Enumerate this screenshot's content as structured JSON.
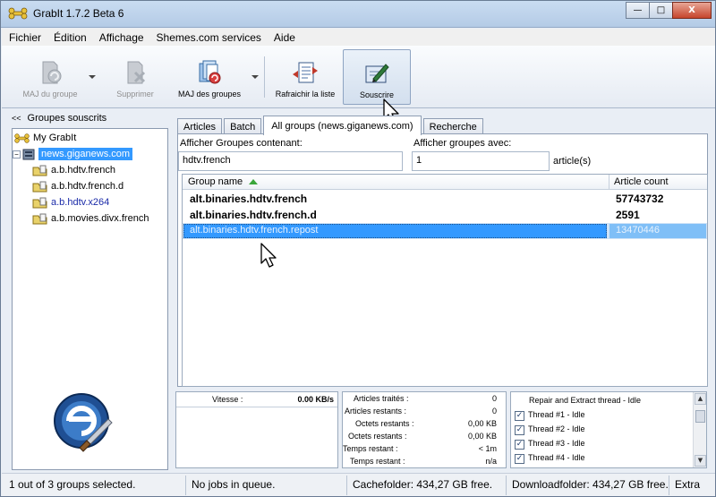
{
  "window": {
    "title": "GrabIt 1.7.2 Beta 6",
    "minimize": "—",
    "maximize": "□",
    "close": "X"
  },
  "menu": [
    "Fichier",
    "Édition",
    "Affichage",
    "Shemes.com services",
    "Aide"
  ],
  "toolbar": {
    "maj_groupe": "MAJ du groupe",
    "supprimer": "Supprimer",
    "maj_groupes": "MAJ des groupes",
    "rafraichir": "Rafraichir la liste",
    "souscrire": "Souscrire"
  },
  "left": {
    "header": "Groupes souscrits",
    "chevron": "<<",
    "tree": {
      "root": "My GrabIt",
      "server": "news.giganews.com",
      "expander": "−",
      "groups": [
        "a.b.hdtv.french",
        "a.b.hdtv.french.d",
        "a.b.hdtv.x264",
        "a.b.movies.divx.french"
      ]
    }
  },
  "tabs": [
    "Articles",
    "Batch",
    "All groups (news.giganews.com)",
    "Recherche"
  ],
  "filter": {
    "contain_label": "Afficher Groupes contenant:",
    "contain_value": "hdtv.french",
    "with_label": "Afficher groupes avec:",
    "with_value": "1",
    "with_unit": "article(s)"
  },
  "grid": {
    "col_name": "Group name",
    "col_count": "Article count",
    "rows": [
      {
        "name": "alt.binaries.hdtv.french",
        "count": "57743732"
      },
      {
        "name": "alt.binaries.hdtv.french.d",
        "count": "2591"
      },
      {
        "name": "alt.binaries.hdtv.french.repost",
        "count": "13470446"
      }
    ]
  },
  "speed": {
    "label": "Vitesse :",
    "value": "0.00 KB/s"
  },
  "stats": [
    {
      "label": "Articles traités :",
      "value": "0"
    },
    {
      "label": "Articles restants :",
      "value": "0"
    },
    {
      "label": "Octets restants :",
      "value": "0,00 KB"
    },
    {
      "label": "Octets restants :",
      "value": "0,00 KB"
    },
    {
      "label": "Temps restant :",
      "value": "< 1m"
    },
    {
      "label": "Temps restant :",
      "value": "n/a"
    }
  ],
  "threads": {
    "header": "Repair and Extract thread - Idle",
    "items": [
      "Thread #1 - Idle",
      "Thread #2 - Idle",
      "Thread #3 - Idle",
      "Thread #4 - Idle"
    ],
    "check_mark": "✓"
  },
  "status": {
    "selection": "1 out of 3 groups selected.",
    "jobs": "No jobs in queue.",
    "cache": "Cachefolder: 434,27 GB free.",
    "download": "Downloadfolder: 434,27 GB free.",
    "extra": "Extra"
  },
  "colors": {
    "selection": "#3399ff",
    "title_gradient": "#b4cbe6",
    "close_button": "#c6452c"
  }
}
